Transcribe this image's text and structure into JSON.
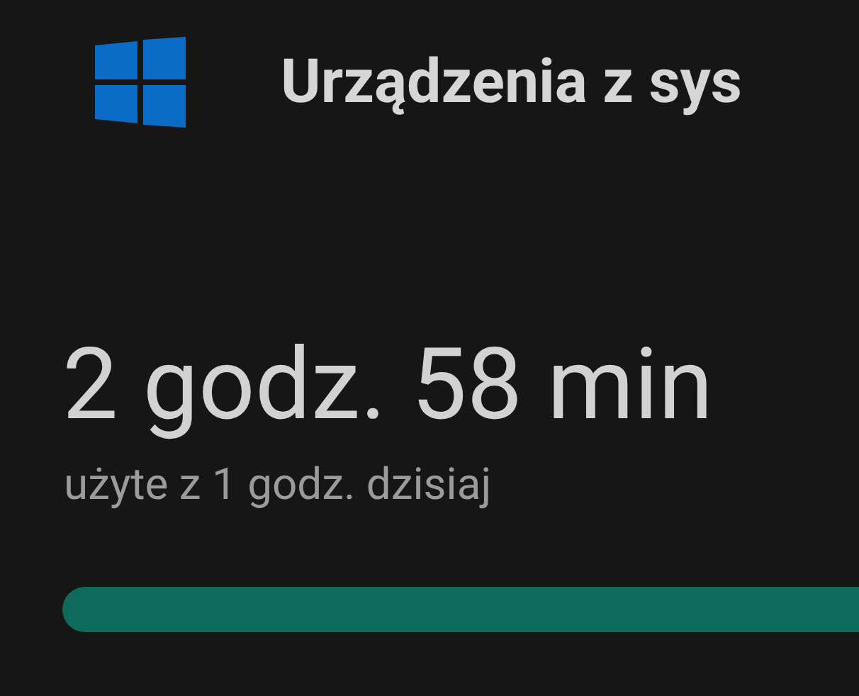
{
  "header": {
    "title": "Urządzenia z sys"
  },
  "usage": {
    "time": "2 godz. 58 min",
    "subtitle": "użyte z 1 godz. dzisiaj",
    "level": 1
  }
}
